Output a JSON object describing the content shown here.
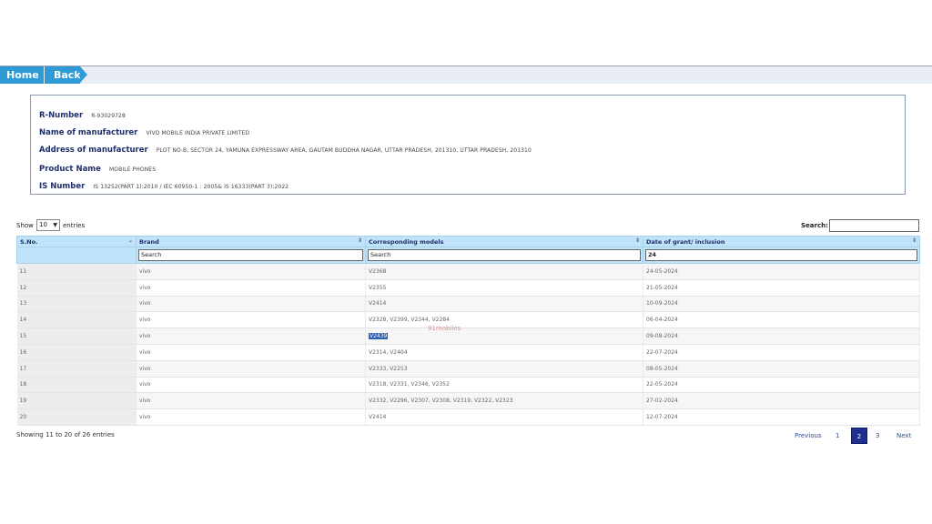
{
  "nav": {
    "home": "Home",
    "back": "Back"
  },
  "info": {
    "r_number_label": "R-Number",
    "r_number": "R-93029728",
    "manufacturer_label": "Name of manufacturer",
    "manufacturer": "VIVO MOBILE INDIA PRIVATE LIMITED",
    "address_label": "Address of manufacturer",
    "address": "PLOT NO-B, SECTOR 24, YAMUNA EXPRESSWAY AREA, GAUTAM BUDDHA NAGAR, UTTAR PRADESH, 201310, UTTAR PRADESH, 201310",
    "product_label": "Product Name",
    "product": "MOBILE PHONES",
    "is_label": "IS Number",
    "is_number": "IS 13252(PART 1):2010 / IEC 60950-1 : 2005& IS 16333(PART 3):2022"
  },
  "controls": {
    "show": "Show",
    "entries_value": "10",
    "entries": "entries",
    "search_label": "Search:"
  },
  "table": {
    "headers": [
      "S.No.",
      "Brand",
      "Corresponding models",
      "Date of grant/ inclusion"
    ],
    "filters": [
      "",
      "Search",
      "Search",
      "24"
    ],
    "rows": [
      [
        "11",
        "vivo",
        "V2368",
        "24-05-2024"
      ],
      [
        "12",
        "vivo",
        "V2355",
        "21-05-2024"
      ],
      [
        "13",
        "vivo",
        "V2414",
        "10-09-2024"
      ],
      [
        "14",
        "vivo",
        "V2328, V2399, V2344, V2284",
        "06-04-2024"
      ],
      [
        "15",
        "vivo",
        "V2439",
        "09-08-2024"
      ],
      [
        "16",
        "vivo",
        "V2314, V2404",
        "22-07-2024"
      ],
      [
        "17",
        "vivo",
        "V2333, V2253",
        "08-05-2024"
      ],
      [
        "18",
        "vivo",
        "V2318, V2331, V2346, V2352",
        "22-05-2024"
      ],
      [
        "19",
        "vivo",
        "V2332, V2296, V2307, V2308, V2319, V2322, V2323",
        "27-02-2024"
      ],
      [
        "20",
        "vivo",
        "V2414",
        "12-07-2024"
      ]
    ]
  },
  "watermark": "91mobiles",
  "footer": {
    "info": "Showing 11 to 20 of 26 entries",
    "previous": "Previous",
    "page1": "1",
    "page2": "2",
    "page3": "3",
    "next": "Next"
  }
}
